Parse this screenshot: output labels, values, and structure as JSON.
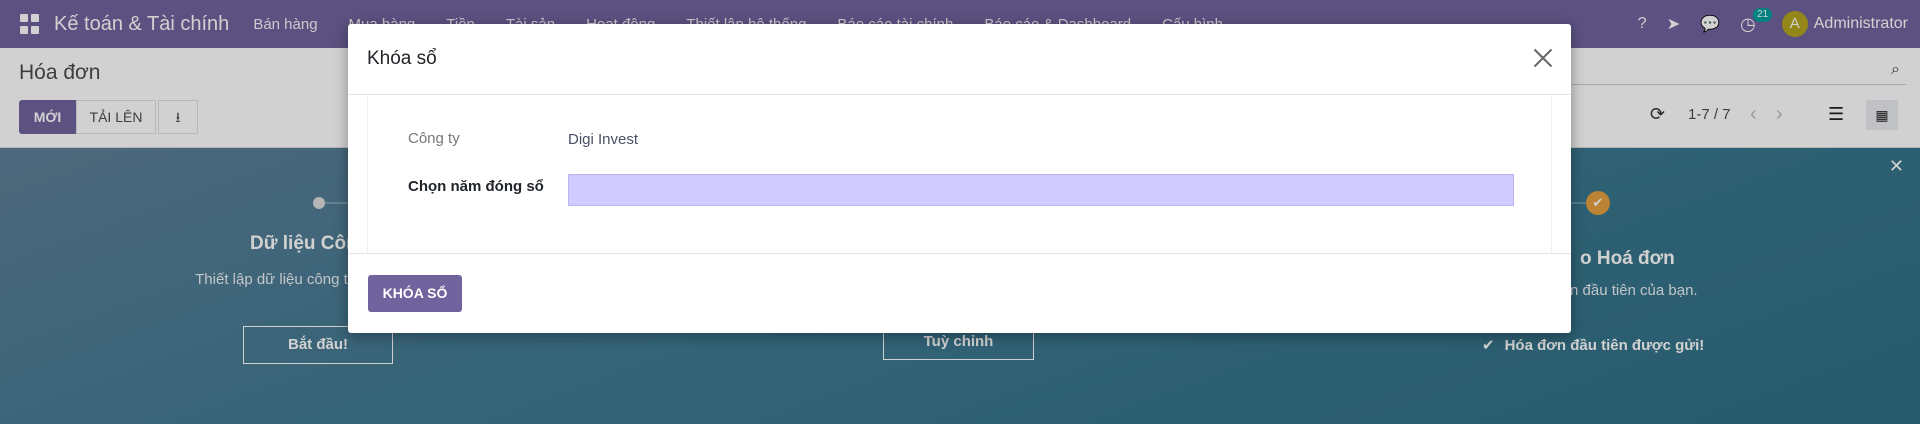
{
  "navbar": {
    "brand": "Kế toán & Tài chính",
    "menu": [
      "Bán hàng",
      "Mua hàng",
      "Tiền",
      "Tài sản",
      "Hoạt động",
      "Thiết lập hệ thống",
      "Báo cáo tài chính",
      "Báo cáo & Dashboard",
      "Cấu hình"
    ],
    "activity_count": "21",
    "avatar_letter": "A",
    "user_name": "Administrator"
  },
  "control_panel": {
    "title": "Hóa đơn",
    "new_label": "MỚI",
    "upload_label": "TẢI LÊN",
    "pager": "1-7 / 7"
  },
  "onboarding": {
    "step1_title": "Dữ liệu Côn",
    "step1_desc": "Thiết lập dữ liệu công ty trên và lề dưới",
    "step1_button": "Bắt đầu!",
    "step2_button": "Tuỳ chỉnh",
    "step3_title": "o Hoá đơn",
    "step3_desc": "n đầu tiên của bạn.",
    "step3_done": "Hóa đơn đầu tiên được gửi!"
  },
  "modal": {
    "title": "Khóa sổ",
    "company_label": "Công ty",
    "company_value": "Digi Invest",
    "year_label": "Chọn năm đóng sổ",
    "year_value": "",
    "submit_label": "KHÓA SỔ"
  },
  "colors": {
    "brand": "#71639e",
    "input_highlight": "#d0ccff",
    "step_done": "#e6a041"
  }
}
